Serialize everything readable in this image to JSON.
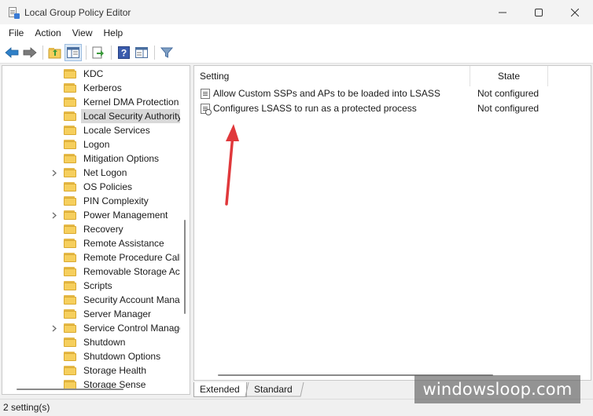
{
  "window": {
    "title": "Local Group Policy Editor"
  },
  "menu": [
    "File",
    "Action",
    "View",
    "Help"
  ],
  "toolbar": {
    "buttons": [
      "back-icon",
      "forward-icon",
      "up-folder-icon",
      "show-hide-tree-icon",
      "export-list-icon",
      "help-icon",
      "properties-pane-icon",
      "filter-icon"
    ]
  },
  "tree": {
    "items": [
      {
        "label": "KDC",
        "expandable": false,
        "selected": false
      },
      {
        "label": "Kerberos",
        "expandable": false,
        "selected": false
      },
      {
        "label": "Kernel DMA Protection",
        "expandable": false,
        "selected": false
      },
      {
        "label": "Local Security Authority",
        "expandable": false,
        "selected": true
      },
      {
        "label": "Locale Services",
        "expandable": false,
        "selected": false
      },
      {
        "label": "Logon",
        "expandable": false,
        "selected": false
      },
      {
        "label": "Mitigation Options",
        "expandable": false,
        "selected": false
      },
      {
        "label": "Net Logon",
        "expandable": true,
        "selected": false
      },
      {
        "label": "OS Policies",
        "expandable": false,
        "selected": false
      },
      {
        "label": "PIN Complexity",
        "expandable": false,
        "selected": false
      },
      {
        "label": "Power Management",
        "expandable": true,
        "selected": false
      },
      {
        "label": "Recovery",
        "expandable": false,
        "selected": false
      },
      {
        "label": "Remote Assistance",
        "expandable": false,
        "selected": false
      },
      {
        "label": "Remote Procedure Call",
        "expandable": false,
        "selected": false
      },
      {
        "label": "Removable Storage Access",
        "expandable": false,
        "selected": false
      },
      {
        "label": "Scripts",
        "expandable": false,
        "selected": false
      },
      {
        "label": "Security Account Manager",
        "expandable": false,
        "selected": false
      },
      {
        "label": "Server Manager",
        "expandable": false,
        "selected": false
      },
      {
        "label": "Service Control Manager",
        "expandable": true,
        "selected": false
      },
      {
        "label": "Shutdown",
        "expandable": false,
        "selected": false
      },
      {
        "label": "Shutdown Options",
        "expandable": false,
        "selected": false
      },
      {
        "label": "Storage Health",
        "expandable": false,
        "selected": false
      },
      {
        "label": "Storage Sense",
        "expandable": false,
        "selected": false
      }
    ]
  },
  "list": {
    "columns": {
      "setting": "Setting",
      "state": "State"
    },
    "rows": [
      {
        "setting": "Allow Custom SSPs and APs to be loaded into LSASS",
        "state": "Not configured",
        "icon": "policy-setting-icon"
      },
      {
        "setting": "Configures LSASS to run as a protected process",
        "state": "Not configured",
        "icon": "policy-setting-gear-icon"
      }
    ]
  },
  "tabs": [
    "Extended",
    "Standard"
  ],
  "status": {
    "text": "2 setting(s)"
  },
  "watermark": {
    "text": "windowsloop.com"
  },
  "colors": {
    "annotation_arrow": "#e0383b",
    "selection": "#d9d9d9",
    "folder": "#f6cf5d"
  }
}
